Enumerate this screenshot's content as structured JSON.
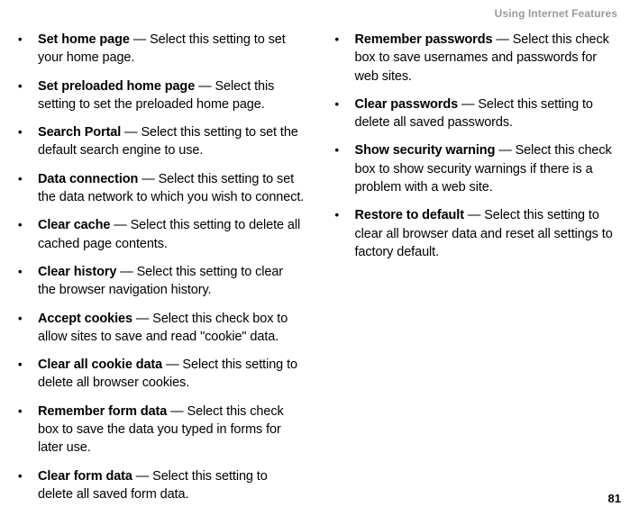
{
  "header": "Using Internet Features",
  "pagenum": "81",
  "bullet": "•",
  "sep": " — ",
  "left": [
    {
      "term": "Set home page",
      "desc": "Select this setting to set your home page."
    },
    {
      "term": "Set preloaded home page",
      "desc": "Select this setting to set the preloaded home page."
    },
    {
      "term": "Search Portal",
      "desc": "Select this setting to set the default search engine to use."
    },
    {
      "term": "Data connection",
      "desc": "Select this setting to set the data network to which you wish to connect."
    },
    {
      "term": "Clear cache",
      "desc": "Select this setting to delete all cached page contents."
    },
    {
      "term": "Clear history",
      "desc": "Select this setting to clear the browser navigation history."
    },
    {
      "term": "Accept cookies",
      "desc": "Select this check box to allow sites to save and read \"cookie\" data."
    },
    {
      "term": "Clear all cookie data",
      "desc": "Select this setting to delete all browser cookies."
    },
    {
      "term": "Remember form data",
      "desc": "Select this check box to save the data you typed in forms for later use."
    },
    {
      "term": "Clear form data",
      "desc": "Select this setting to delete all saved form data."
    }
  ],
  "right": [
    {
      "term": "Remember passwords",
      "desc": "Select this check box to save usernames and passwords for web sites."
    },
    {
      "term": "Clear passwords",
      "desc": "Select this setting to delete all saved passwords."
    },
    {
      "term": "Show security warning",
      "desc": "Select this check box to show security warnings if there is a problem with a web site."
    },
    {
      "term": "Restore to default",
      "desc": "Select this setting to clear all browser data and reset all settings to factory default."
    }
  ]
}
